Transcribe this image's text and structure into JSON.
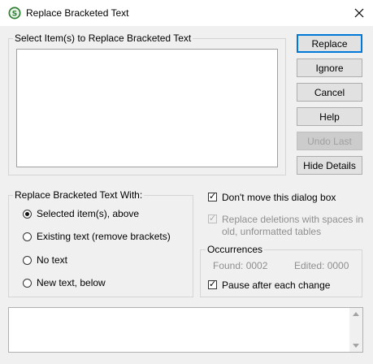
{
  "window": {
    "title": "Replace Bracketed Text",
    "icon": "app-logo-icon",
    "close_icon": "close-icon"
  },
  "select_group": {
    "label": "Select Item(s) to Replace Bracketed Text",
    "items": []
  },
  "buttons": {
    "replace": "Replace",
    "ignore": "Ignore",
    "cancel": "Cancel",
    "help": "Help",
    "undo_last": "Undo Last",
    "hide_details": "Hide Details"
  },
  "replace_with": {
    "label": "Replace Bracketed Text With:",
    "options": [
      {
        "label": "Selected item(s), above",
        "checked": true
      },
      {
        "label": "Existing text (remove brackets)",
        "checked": false
      },
      {
        "label": "No text",
        "checked": false
      },
      {
        "label": "New text, below",
        "checked": false
      }
    ]
  },
  "options": {
    "dont_move": {
      "label": "Don't move this dialog box",
      "checked": true
    },
    "replace_deletions": {
      "label_line1": "Replace deletions with spaces in",
      "label_line2": "old, unformatted tables",
      "checked": true,
      "disabled": true
    }
  },
  "occurrences": {
    "label": "Occurrences",
    "found": "Found: 0002",
    "edited": "Edited: 0000",
    "pause": {
      "label": "Pause after each change",
      "checked": true
    }
  },
  "details": {
    "text": ""
  },
  "colors": {
    "default_button_border": "#0078d7",
    "disabled_text": "#8f8f8f"
  }
}
